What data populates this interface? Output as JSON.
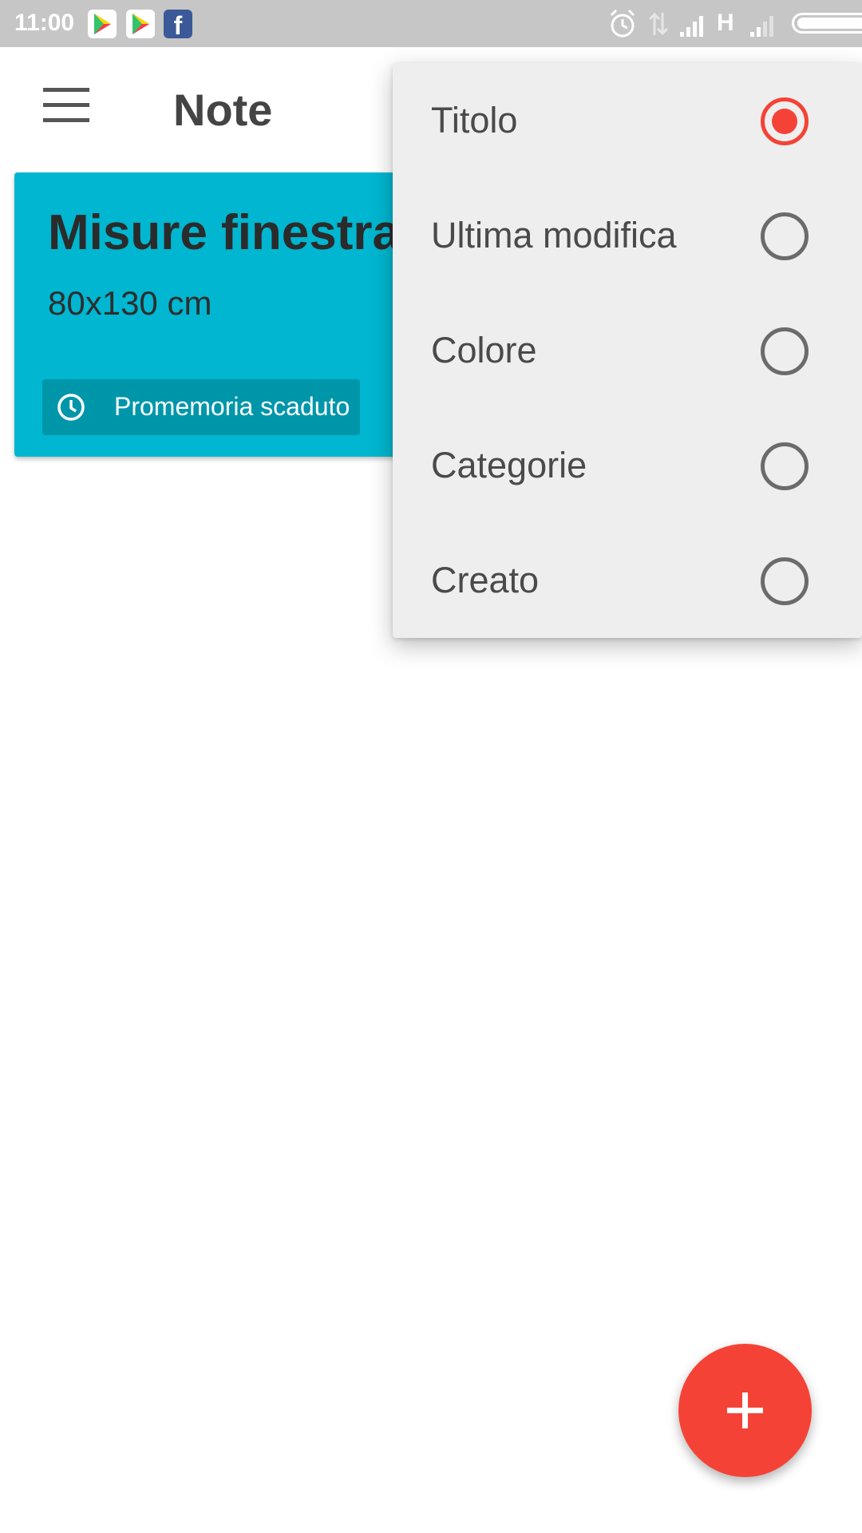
{
  "status_bar": {
    "time": "11:00",
    "network_type": "H",
    "notification_icons": [
      "play-store-icon",
      "play-store-icon",
      "facebook-icon"
    ],
    "system_icons": [
      "alarm-icon",
      "data-transfer-icon",
      "signal-icon",
      "signal-weak-icon",
      "battery-icon"
    ]
  },
  "app_bar": {
    "title": "Note",
    "menu_icon": "hamburger-menu-icon"
  },
  "notes": [
    {
      "title": "Misure finestra",
      "body": "80x130 cm",
      "reminder": "Promemoria scaduto",
      "color": "#00b6d0"
    }
  ],
  "sort_menu": {
    "options": [
      {
        "label": "Titolo",
        "selected": true
      },
      {
        "label": "Ultima modifica",
        "selected": false
      },
      {
        "label": "Colore",
        "selected": false
      },
      {
        "label": "Categorie",
        "selected": false
      },
      {
        "label": "Creato",
        "selected": false
      }
    ]
  },
  "fab": {
    "icon": "plus-icon",
    "color": "#f44336"
  },
  "colors": {
    "accent": "#f44336",
    "note_cyan": "#00b6d0",
    "chip": "#0096aa"
  }
}
